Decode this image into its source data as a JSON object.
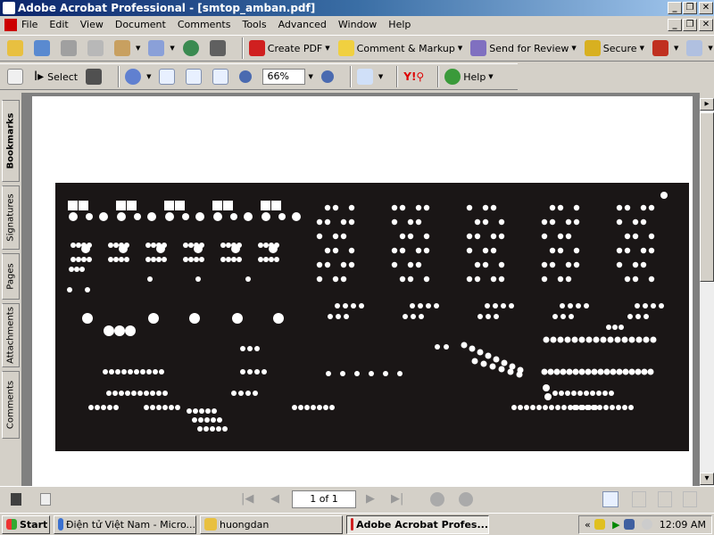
{
  "window": {
    "title": "Adobe Acrobat Professional - [smtop_amban.pdf]"
  },
  "menu": [
    "File",
    "Edit",
    "View",
    "Document",
    "Comments",
    "Tools",
    "Advanced",
    "Window",
    "Help"
  ],
  "toolbar1": {
    "create_pdf": "Create PDF",
    "comment_markup": "Comment & Markup",
    "send_review": "Send for Review",
    "secure": "Secure"
  },
  "toolbar2": {
    "select": "Select",
    "zoom": "66%",
    "help": "Help"
  },
  "side_tabs": [
    "Bookmarks",
    "Signatures",
    "Pages",
    "Attachments",
    "Comments"
  ],
  "status": {
    "page": "1 of 1"
  },
  "taskbar": {
    "start": "Start",
    "tasks": [
      "Điện tử Việt Nam - Micro...",
      "huongdan",
      "Adobe Acrobat Profes..."
    ],
    "clock": "12:09 AM"
  }
}
